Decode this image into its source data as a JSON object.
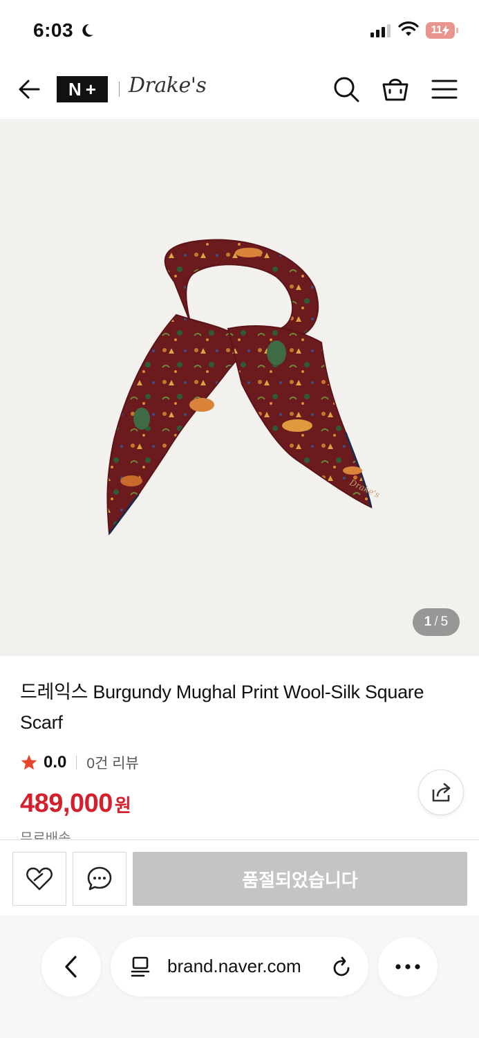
{
  "status_bar": {
    "time": "6:03",
    "battery": "11"
  },
  "header": {
    "logo_nplus": [
      "N",
      "+"
    ],
    "logo_brand": "Drake's"
  },
  "gallery": {
    "current": "1",
    "separator": "/",
    "total": "5",
    "scarf_logo": "Drake's"
  },
  "product": {
    "title": "드레익스 Burgundy Mughal Print Wool-Silk Square Scarf",
    "rating": "0.0",
    "review_count": "0건 리뷰",
    "price": "489,000",
    "price_unit": "원",
    "shipping_peek": "무료배송"
  },
  "actions": {
    "soldout_label": "품절되었습니다"
  },
  "browser": {
    "url": "brand.naver.com"
  },
  "colors": {
    "price_red": "#d4202c",
    "star": "#e8452c",
    "soldout_bg": "#c4c4c4",
    "scarf_burgundy": "#6b1a1e"
  }
}
